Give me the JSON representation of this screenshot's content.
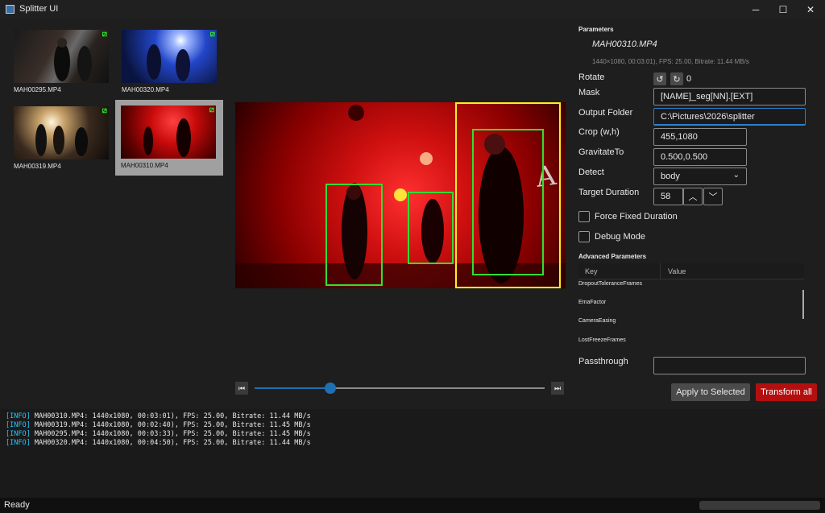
{
  "window": {
    "title": "Splitter UI",
    "controls": {
      "minimize": "─",
      "maximize": "☐",
      "close": "✕"
    }
  },
  "thumbnails": [
    {
      "name": "MAH00295.MP4",
      "selected": false
    },
    {
      "name": "MAH00320.MP4",
      "selected": false
    },
    {
      "name": "MAH00319.MP4",
      "selected": false
    },
    {
      "name": "MAH00310.MP4",
      "selected": true
    }
  ],
  "player": {
    "prev_icon": "skip-back-icon",
    "next_icon": "skip-forward-icon",
    "position_fraction": 0.26,
    "detections": 4
  },
  "parameters": {
    "section_title": "Parameters",
    "file_name": "MAH00310.MP4",
    "file_info": "1440×1080, 00:03:01), FPS: 25.00, Bitrate: 11.44 MB/s",
    "rotate_label": "Rotate",
    "rotate_value": "0",
    "mask_label": "Mask",
    "mask_value": "[NAME]_seg[NN].[EXT]",
    "output_folder_label": "Output Folder",
    "output_folder_value": "C:\\Pictures\\2026\\splitter",
    "crop_label": "Crop (w,h)",
    "crop_value": "455,1080",
    "gravitate_label": "GravitateTo",
    "gravitate_value": "0.500,0.500",
    "detect_label": "Detect",
    "detect_value": "body",
    "target_duration_label": "Target Duration",
    "target_duration_value": "58",
    "force_fixed_label": "Force Fixed Duration",
    "debug_mode_label": "Debug Mode",
    "advanced_title": "Advanced Parameters",
    "advanced_columns": [
      "Key",
      "Value"
    ],
    "advanced_rows": [
      "DropoutToleranceFrames",
      "EmaFactor",
      "CameraEasing",
      "LostFreezeFrames"
    ],
    "passthrough_label": "Passthrough",
    "passthrough_value": "",
    "apply_button": "Apply to Selected",
    "transform_button": "Transform all"
  },
  "log": [
    {
      "tag": "[INFO]",
      "text": " MAH00310.MP4: 1440x1080, 00:03:01), FPS: 25.00, Bitrate: 11.44 MB/s"
    },
    {
      "tag": "[INFO]",
      "text": " MAH00319.MP4: 1440x1080, 00:02:40), FPS: 25.00, Bitrate: 11.45 MB/s"
    },
    {
      "tag": "[INFO]",
      "text": " MAH00295.MP4: 1440x1080, 00:03:33), FPS: 25.00, Bitrate: 11.45 MB/s"
    },
    {
      "tag": "[INFO]",
      "text": " MAH00320.MP4: 1440x1080, 00:04:50), FPS: 25.00, Bitrate: 11.44 MB/s"
    }
  ],
  "status": {
    "text": "Ready"
  },
  "colors": {
    "accent": "#1f6fb3",
    "transform": "#b30f0f",
    "bbox": "#33dd33",
    "bbox_focus": "#ffee22"
  }
}
